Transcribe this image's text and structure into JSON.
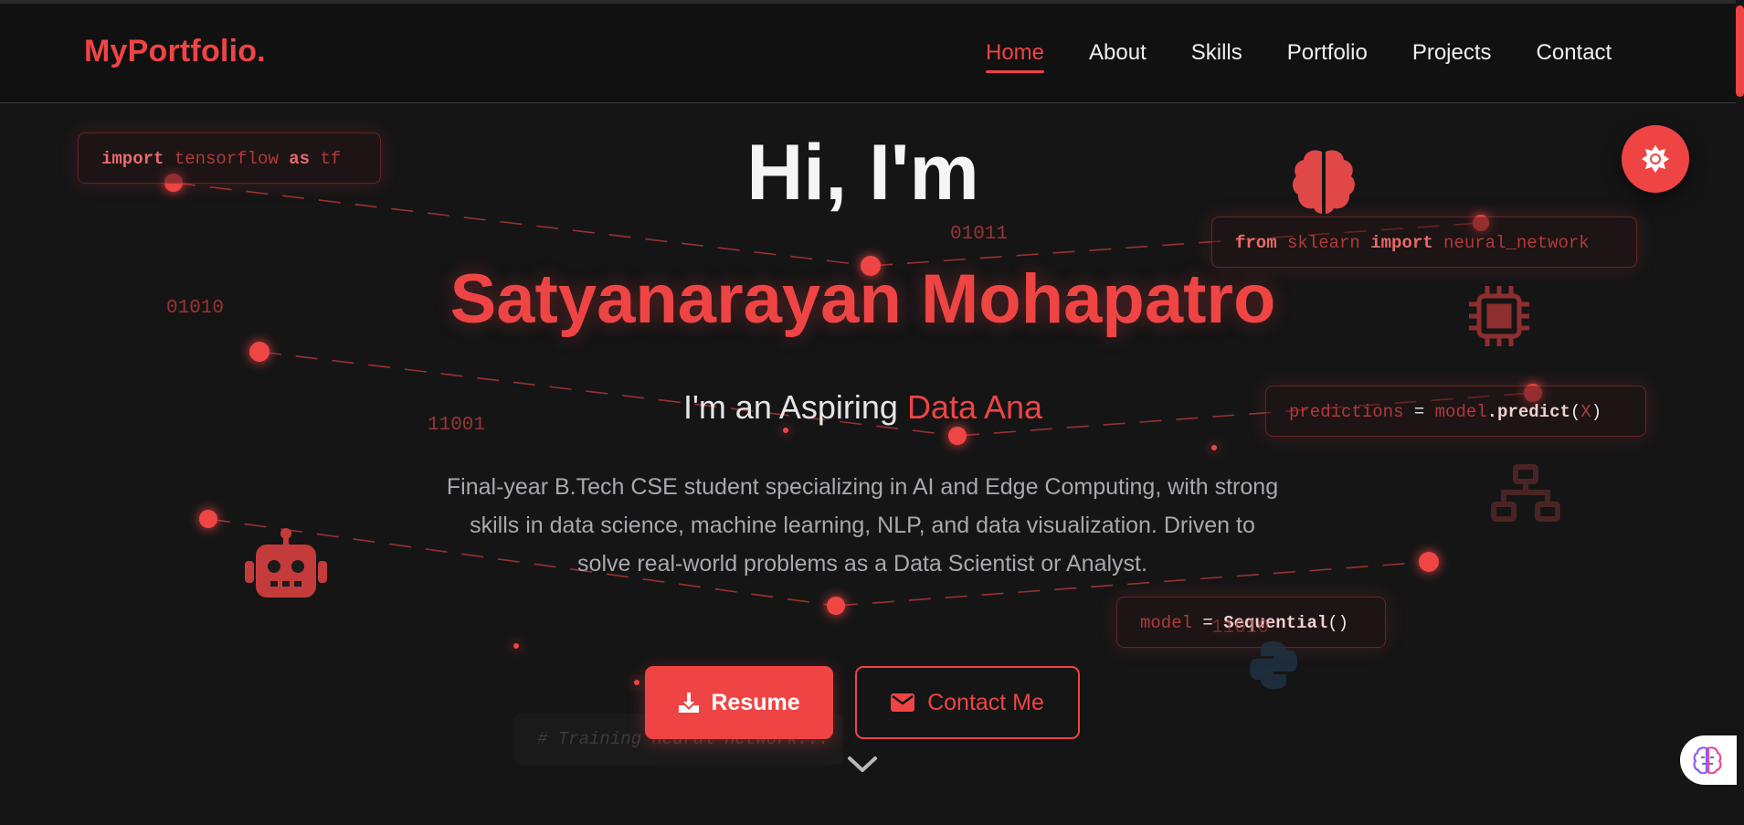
{
  "colors": {
    "accent": "#ef4444",
    "background": "#151516",
    "navbar": "#111112"
  },
  "nav": {
    "brand": "MyPortfolio.",
    "links": [
      "Home",
      "About",
      "Skills",
      "Portfolio",
      "Projects",
      "Contact"
    ],
    "active": "Home"
  },
  "hero": {
    "greeting": "Hi, I'm",
    "name": "Satyanarayan Mohapatro",
    "role_prefix": "I'm an Aspiring ",
    "role_typed": "Data Ana",
    "description": "Final-year B.Tech CSE student specializing in AI and Edge Computing, with strong skills in data science, machine learning, NLP, and data visualization. Driven to solve real-world problems as a Data Scientist or Analyst."
  },
  "buttons": {
    "resume": "Resume",
    "contact": "Contact Me"
  },
  "code_snippets": {
    "tf": {
      "kw1": "import",
      "mod": " tensorflow ",
      "kw2": "as",
      "alias": " tf"
    },
    "sklearn": {
      "kw1": "from",
      "mod": " sklearn ",
      "kw2": "import",
      "name": " neural_network"
    },
    "predict": {
      "var": "predictions",
      "eq": " = ",
      "obj": "model",
      "method": ".predict",
      "open": "(",
      "arg": "X",
      "close": ")"
    },
    "model": {
      "var": "model",
      "eq": " = ",
      "cls": "Sequential",
      "parens": "()"
    },
    "comment": "# Training neural network..."
  },
  "binary_labels": [
    "01011",
    "01010",
    "11001",
    "11010"
  ],
  "icons": [
    "brain-icon",
    "microchip-icon",
    "network-icon",
    "robot-icon",
    "python-icon",
    "download-icon",
    "envelope-icon",
    "chevron-down-icon",
    "sun-icon",
    "ai-brain-icon"
  ]
}
